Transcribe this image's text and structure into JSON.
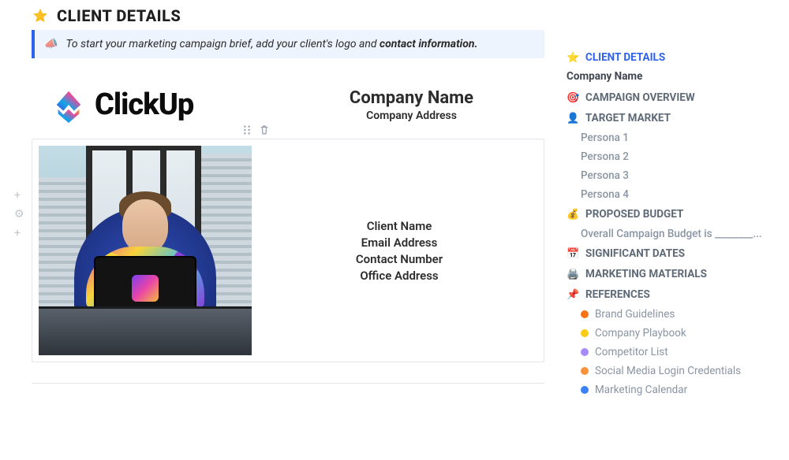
{
  "header": {
    "title": "CLIENT DETAILS"
  },
  "callout": {
    "text_prefix": "To start your marketing campaign brief, add your client's logo and ",
    "text_bold": "contact information."
  },
  "company": {
    "logo_text": "ClickUp",
    "name": "Company Name",
    "address": "Company Address"
  },
  "client_card": {
    "fields": [
      "Client Name",
      "Email Address",
      "Contact Number",
      "Office Address"
    ]
  },
  "outline": {
    "client_details": "CLIENT DETAILS",
    "company_name": "Company Name",
    "campaign_overview": "CAMPAIGN OVERVIEW",
    "target_market": "TARGET MARKET",
    "personas": [
      "Persona 1",
      "Persona 2",
      "Persona 3",
      "Persona 4"
    ],
    "proposed_budget": "PROPOSED BUDGET",
    "budget_sub": "Overall Campaign Budget is ________...",
    "significant_dates": "SIGNIFICANT DATES",
    "marketing_materials": "MARKETING MATERIALS",
    "references": "REFERENCES",
    "refs": [
      {
        "label": "Brand Guidelines",
        "color": "#f97316"
      },
      {
        "label": "Company Playbook",
        "color": "#facc15"
      },
      {
        "label": "Competitor List",
        "color": "#a78bfa"
      },
      {
        "label": "Social Media Login Credentials",
        "color": "#fb923c"
      },
      {
        "label": "Marketing Calendar",
        "color": "#3b82f6"
      }
    ]
  }
}
